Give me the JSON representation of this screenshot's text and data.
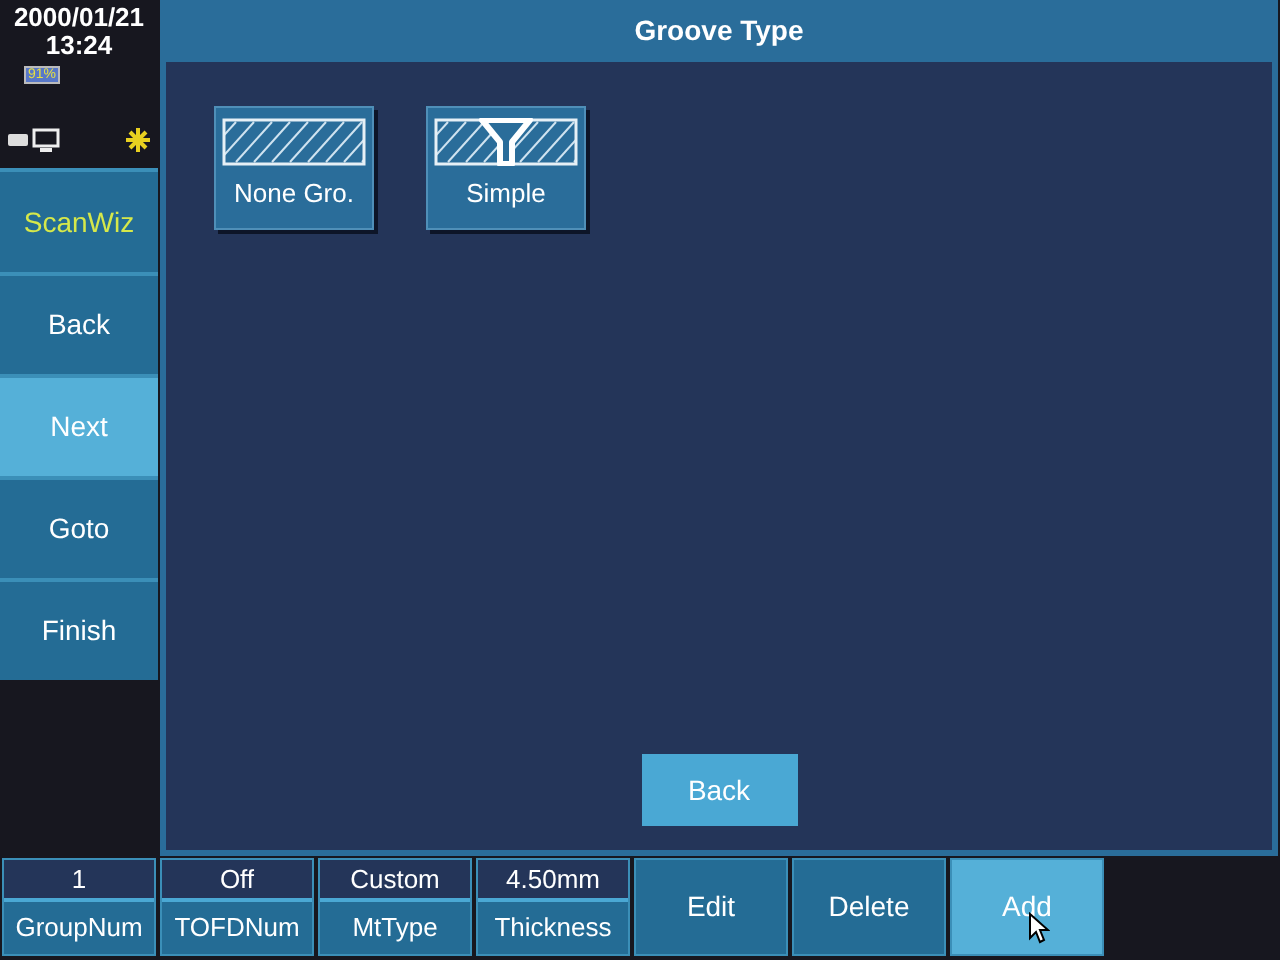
{
  "status": {
    "date": "2000/01/21",
    "time": "13:24",
    "battery": "91%"
  },
  "sidebar": {
    "title": "ScanWiz",
    "items": [
      {
        "label": "Back",
        "selected": false
      },
      {
        "label": "Next",
        "selected": true
      },
      {
        "label": "Goto",
        "selected": false
      },
      {
        "label": "Finish",
        "selected": false
      }
    ]
  },
  "panel": {
    "title": "Groove Type",
    "options": [
      {
        "label": "None Gro.",
        "kind": "none"
      },
      {
        "label": "Simple",
        "kind": "simple"
      }
    ],
    "back_button": "Back"
  },
  "bottom_bar": {
    "fields": [
      {
        "value": "1",
        "label": "GroupNum"
      },
      {
        "value": "Off",
        "label": "TOFDNum"
      },
      {
        "value": "Custom",
        "label": "MtType"
      },
      {
        "value": "4.50mm",
        "label": "Thickness"
      }
    ],
    "buttons": [
      {
        "label": "Edit",
        "selected": false
      },
      {
        "label": "Delete",
        "selected": false
      },
      {
        "label": "Add",
        "selected": true
      }
    ]
  }
}
